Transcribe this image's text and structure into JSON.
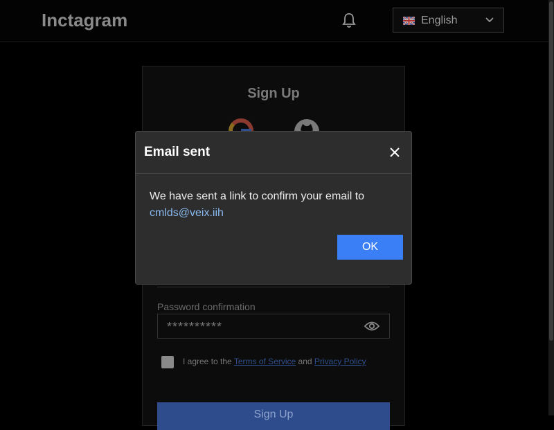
{
  "header": {
    "logo": "Inctagram",
    "language": "English"
  },
  "signup": {
    "title": "Sign Up",
    "password_confirmation_label": "Password confirmation",
    "password_confirmation_value": "**********",
    "agree_prefix": "I agree to the",
    "terms_link": "Terms of Service",
    "agree_and": "and",
    "privacy_link": "Privacy Policy",
    "submit_label": "Sign Up"
  },
  "modal": {
    "title": "Email sent",
    "message": "We have sent a link to confirm your email to",
    "email": "cmlds@veix.iih",
    "ok_label": "OK"
  },
  "icons": {
    "bell": "bell-icon",
    "flag": "uk-flag-icon",
    "chevron": "chevron-down-icon",
    "google": "google-icon",
    "github": "github-icon",
    "eye": "eye-icon",
    "close": "close-icon"
  },
  "colors": {
    "background": "#000000",
    "modal_background": "#2d2d2d",
    "primary": "#3a7ff6",
    "link": "#8ab8f0"
  }
}
